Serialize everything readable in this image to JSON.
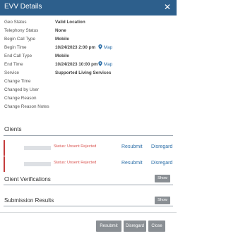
{
  "dialog": {
    "title": "EVV Details"
  },
  "fields": [
    {
      "label": "Geo Status",
      "value": "Valid Location"
    },
    {
      "label": "Telephony Status",
      "value": "None"
    },
    {
      "label": "Begin Call Type",
      "value": "Mobile"
    },
    {
      "label": "Begin Time",
      "value": "10/24/2023 2:00 pm",
      "map": "Map"
    },
    {
      "label": "End Call Type",
      "value": "Mobile"
    },
    {
      "label": "End Time",
      "value": "10/24/2023 10:00 pm",
      "map": "Map"
    },
    {
      "label": "Service",
      "value": "Supported Living Services"
    },
    {
      "label": "Change Time",
      "value": ""
    },
    {
      "label": "Changed by User",
      "value": ""
    },
    {
      "label": "Change Reason",
      "value": ""
    },
    {
      "label": "Change Reason Notes",
      "value": ""
    }
  ],
  "clients": {
    "title": "Clients",
    "rows": [
      {
        "status": "Status: Unsent Rejected",
        "resubmit": "Resubmit",
        "disregard": "Disregard"
      },
      {
        "status": "Status: Unsent Rejected",
        "resubmit": "Resubmit",
        "disregard": "Disregard"
      }
    ]
  },
  "client_verifications": {
    "title": "Client Verifications",
    "show_label": "Show"
  },
  "submission_results": {
    "title": "Submission Results",
    "show_label": "Show"
  },
  "footer": {
    "resubmit": "Resubmit",
    "disregard": "Disregard",
    "close": "Close"
  },
  "colors": {
    "header": "#2d5f8c",
    "link": "#2d6fa8",
    "error": "#c43b3b",
    "button": "#8a8f94"
  },
  "icons": {
    "close": "close-icon",
    "map": "map-pin-icon"
  }
}
